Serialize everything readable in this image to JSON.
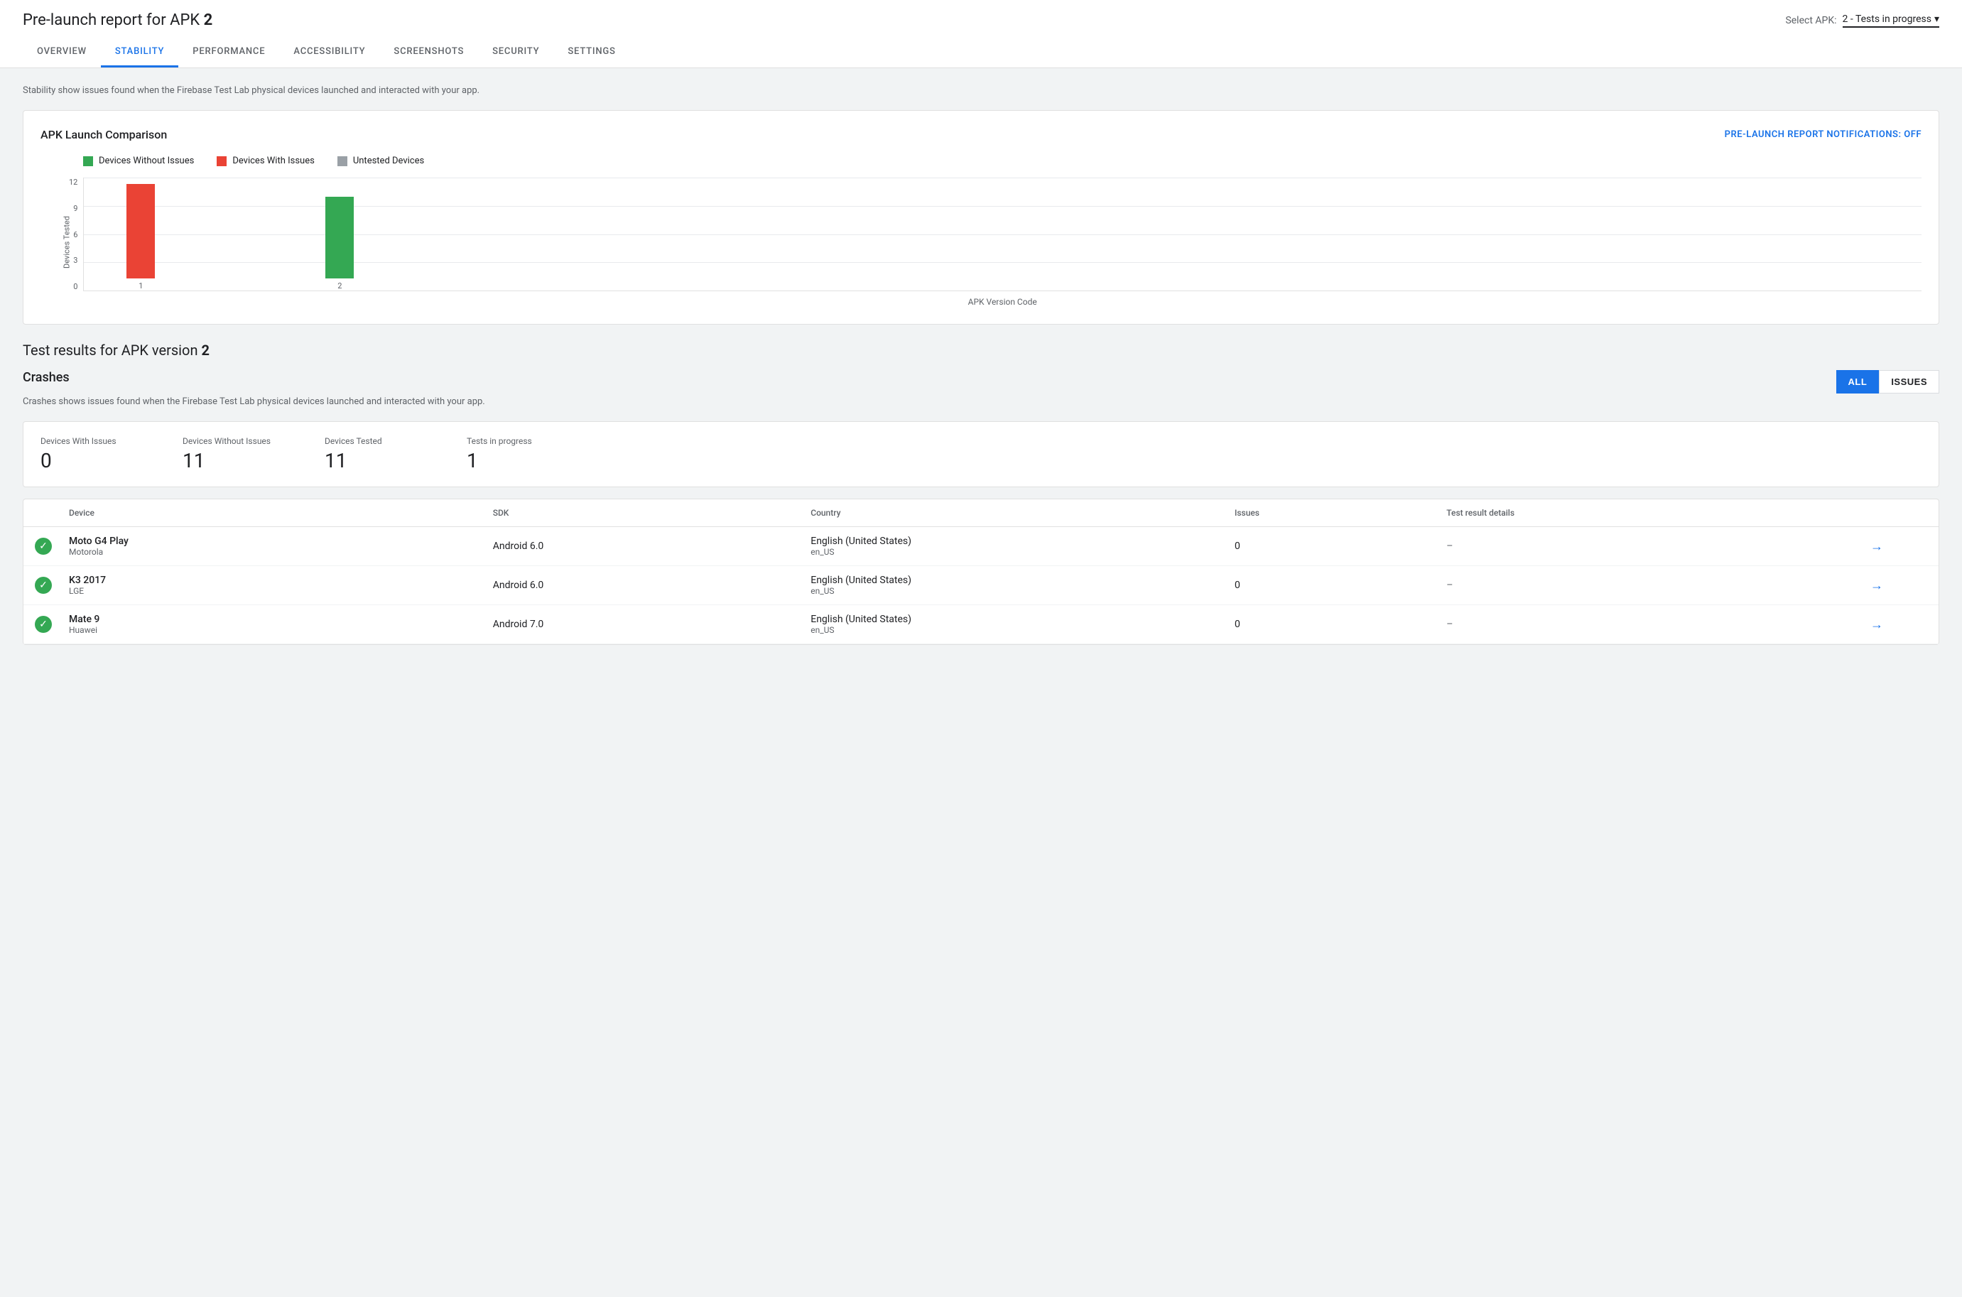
{
  "header": {
    "title": "Pre-launch report for APK ",
    "title_bold": "2",
    "select_apk_label": "Select APK:",
    "select_apk_value": "2 - Tests in progress"
  },
  "tabs": [
    {
      "id": "overview",
      "label": "OVERVIEW",
      "active": false
    },
    {
      "id": "stability",
      "label": "STABILITY",
      "active": true
    },
    {
      "id": "performance",
      "label": "PERFORMANCE",
      "active": false
    },
    {
      "id": "accessibility",
      "label": "ACCESSIBILITY",
      "active": false
    },
    {
      "id": "screenshots",
      "label": "SCREENSHOTS",
      "active": false
    },
    {
      "id": "security",
      "label": "SECURITY",
      "active": false
    },
    {
      "id": "settings",
      "label": "SETTINGS",
      "active": false
    }
  ],
  "stability": {
    "description": "Stability show issues found when the Firebase Test Lab physical devices launched and interacted with your app.",
    "chart": {
      "title": "APK Launch Comparison",
      "notification_label": "PRE-LAUNCH REPORT NOTIFICATIONS: OFF",
      "legend": [
        {
          "label": "Devices Without Issues",
          "color": "#34a853"
        },
        {
          "label": "Devices With Issues",
          "color": "#ea4335"
        },
        {
          "label": "Untested Devices",
          "color": "#9aa0a6"
        }
      ],
      "y_axis_label": "Devices Tested",
      "x_axis_label": "APK Version Code",
      "y_labels": [
        "12",
        "9",
        "6",
        "3",
        "0"
      ],
      "bars": [
        {
          "x_label": "1",
          "color": "#ea4335",
          "height_pct": 83
        },
        {
          "x_label": "2",
          "color": "#34a853",
          "height_pct": 72
        }
      ]
    },
    "test_results_title": "Test results for APK version ",
    "test_results_bold": "2",
    "crashes": {
      "title": "Crashes",
      "description": "Crashes shows issues found when the Firebase Test Lab physical devices launched and interacted with your app.",
      "filter_all": "ALL",
      "filter_issues": "ISSUES",
      "stats": [
        {
          "label": "Devices With Issues",
          "value": "0"
        },
        {
          "label": "Devices Without Issues",
          "value": "11"
        },
        {
          "label": "Devices Tested",
          "value": "11"
        },
        {
          "label": "Tests in progress",
          "value": "1"
        }
      ],
      "table_headers": [
        "",
        "Device",
        "SDK",
        "Country",
        "Issues",
        "Test result details",
        ""
      ],
      "rows": [
        {
          "status": "pass",
          "device_name": "Moto G4 Play",
          "manufacturer": "Motorola",
          "sdk": "Android 6.0",
          "country": "English (United States)",
          "locale": "en_US",
          "issues": "0",
          "details": "–"
        },
        {
          "status": "pass",
          "device_name": "K3 2017",
          "manufacturer": "LGE",
          "sdk": "Android 6.0",
          "country": "English (United States)",
          "locale": "en_US",
          "issues": "0",
          "details": "–"
        },
        {
          "status": "pass",
          "device_name": "Mate 9",
          "manufacturer": "Huawei",
          "sdk": "Android 7.0",
          "country": "English (United States)",
          "locale": "en_US",
          "issues": "0",
          "details": "–"
        }
      ]
    }
  }
}
